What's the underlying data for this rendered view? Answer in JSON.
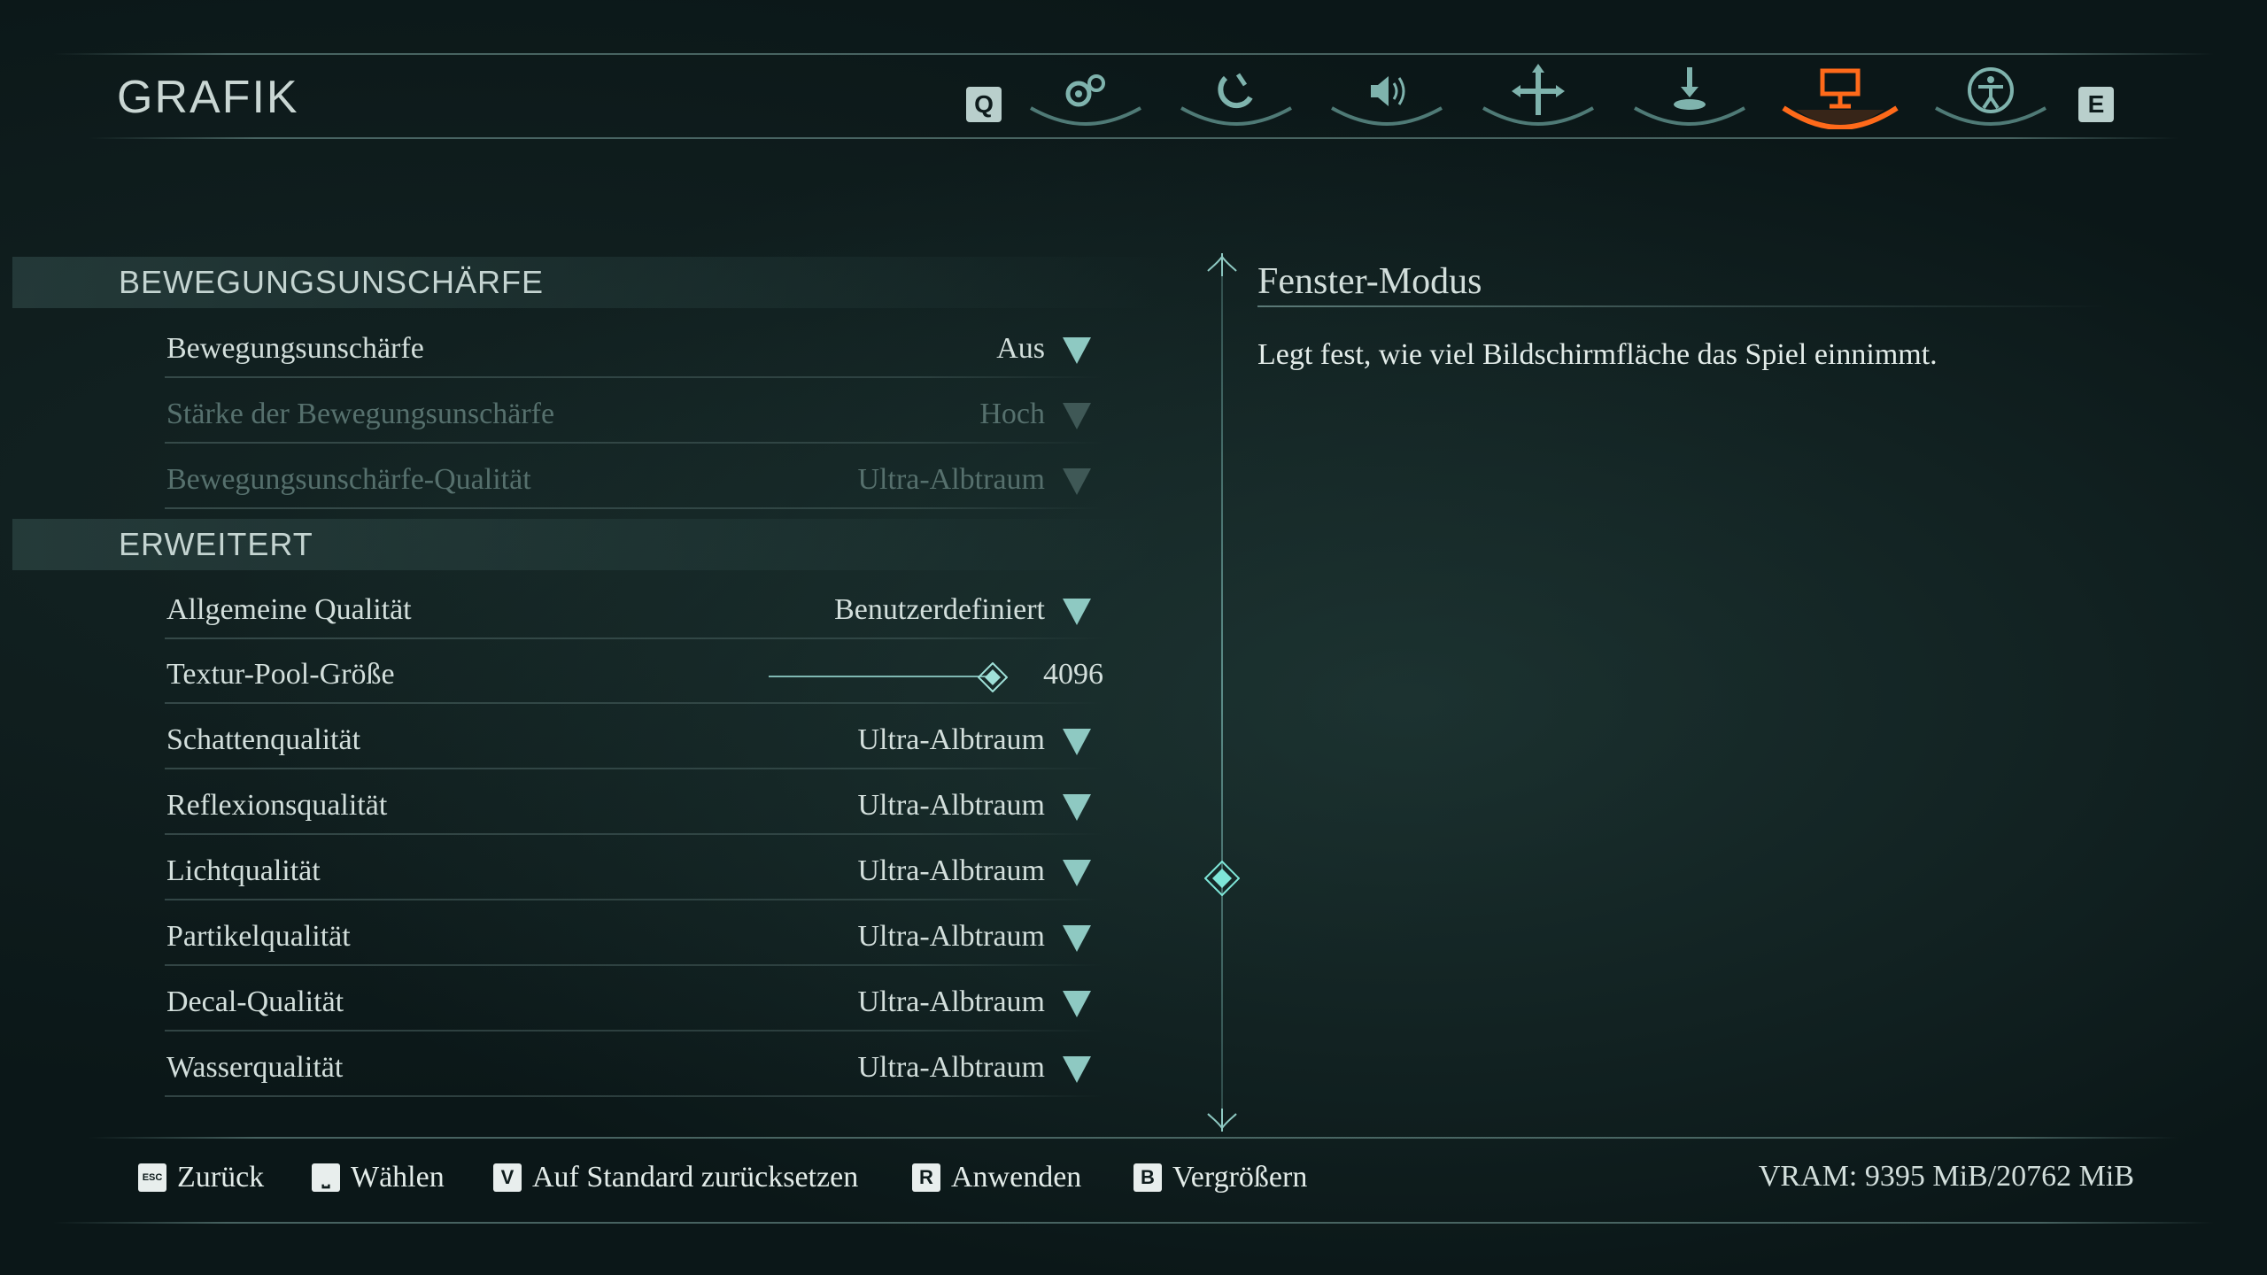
{
  "header": {
    "title": "GRAFIK",
    "left_key": "Q",
    "right_key": "E",
    "tabs": [
      {
        "icon": "gears-icon",
        "active": false
      },
      {
        "icon": "controller-icon",
        "active": false
      },
      {
        "icon": "speaker-icon",
        "active": false
      },
      {
        "icon": "move-cross-icon",
        "active": false
      },
      {
        "icon": "download-icon",
        "active": false
      },
      {
        "icon": "monitor-icon",
        "active": true
      },
      {
        "icon": "accessibility-icon",
        "active": false
      }
    ],
    "active_color": "#ff6a1a"
  },
  "sections": [
    {
      "title": "BEWEGUNGSUNSCHÄRFE",
      "rows": [
        {
          "label": "Bewegungsunschärfe",
          "value": "Aus",
          "enabled": true
        },
        {
          "label": "Stärke der Bewegungsunschärfe",
          "value": "Hoch",
          "enabled": false
        },
        {
          "label": "Bewegungsunschärfe-Qualität",
          "value": "Ultra-Albtraum",
          "enabled": false
        }
      ]
    },
    {
      "title": "ERWEITERT",
      "rows": [
        {
          "label": "Allgemeine Qualität",
          "value": "Benutzerdefiniert",
          "enabled": true
        },
        {
          "label": "Textur-Pool-Größe",
          "value": "4096",
          "type": "slider",
          "level": 1.0
        },
        {
          "label": "Schattenqualität",
          "value": "Ultra-Albtraum",
          "enabled": true
        },
        {
          "label": "Reflexionsqualität",
          "value": "Ultra-Albtraum",
          "enabled": true
        },
        {
          "label": "Lichtqualität",
          "value": "Ultra-Albtraum",
          "enabled": true
        },
        {
          "label": "Partikelqualität",
          "value": "Ultra-Albtraum",
          "enabled": true
        },
        {
          "label": "Decal-Qualität",
          "value": "Ultra-Albtraum",
          "enabled": true
        },
        {
          "label": "Wasserqualität",
          "value": "Ultra-Albtraum",
          "enabled": true
        }
      ]
    }
  ],
  "description": {
    "title": "Fenster-Modus",
    "text": "Legt fest, wie viel Bildschirmfläche das Spiel einnimmt."
  },
  "footer": {
    "items": [
      {
        "key": "ESC",
        "label": "Zurück"
      },
      {
        "key": "⎵",
        "label": "Wählen"
      },
      {
        "key": "V",
        "label": "Auf Standard zurücksetzen"
      },
      {
        "key": "R",
        "label": "Anwenden"
      },
      {
        "key": "B",
        "label": "Vergrößern"
      }
    ],
    "vram": "VRAM: 9395 MiB/20762 MiB"
  }
}
